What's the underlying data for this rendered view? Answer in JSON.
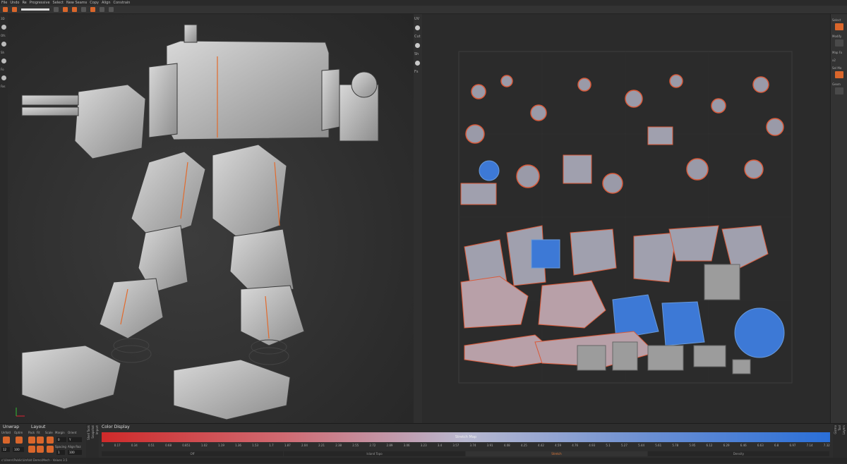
{
  "menubar": {
    "items": [
      "File",
      "Undo",
      "Re",
      "Progressive",
      "Select",
      "New Seams",
      "Copy",
      "Align",
      "Constrain"
    ]
  },
  "viewport_left": {
    "side_labels": [
      "3D",
      "Ofs",
      "Sh",
      "Fo",
      "Fas"
    ]
  },
  "divider": {
    "labels": [
      "UV",
      "Cut",
      "Sh",
      "Fs"
    ]
  },
  "right_strip": {
    "labels": [
      "Select",
      "Modify",
      "Map Fa",
      "Sel Mo",
      "Geom"
    ],
    "value": "x2"
  },
  "unwrap": {
    "title": "Unwrap",
    "title2": "Layout",
    "col_labels": [
      "Unfold",
      "Optim",
      "Pack",
      "Fit",
      "Scale",
      "Margin",
      "Orient"
    ],
    "field_values": [
      "12",
      "100",
      "0",
      "1",
      "100"
    ],
    "spacing_label": "Spacing",
    "align_label": "Align Roz",
    "dropdown": "Y"
  },
  "vertical_tabs": [
    "Shell Tools",
    "Snapshot",
    "Import"
  ],
  "color_display": {
    "title": "Color Display",
    "stretch_label": "Stretch Map",
    "ticks": [
      "0",
      "0.17",
      "0.34",
      "0.51",
      "0.68",
      "0.851",
      "1.02",
      "1.19",
      "1.36",
      "1.53",
      "1.7",
      "1.87",
      "2.04",
      "2.21",
      "2.38",
      "2.55",
      "2.72",
      "2.89",
      "3.06",
      "3.23",
      "3.4",
      "3.57",
      "3.74",
      "3.91",
      "4.08",
      "4.25",
      "4.42",
      "4.59",
      "4.76",
      "4.93",
      "5.1",
      "5.27",
      "5.44",
      "5.61",
      "5.78",
      "5.95",
      "6.12",
      "6.29",
      "6.46",
      "6.63",
      "6.8",
      "6.97",
      "7.14",
      "7.32"
    ],
    "modes": [
      "Off",
      "Island Topo",
      "Stretch",
      "Density"
    ],
    "active_mode": "Stretch"
  },
  "bottom_right_tabs": [
    "Gizmo",
    "Tool",
    "Layers"
  ],
  "status": "c:\\Users\\Public\\Unfold Demo\\Mech - Values 3.5",
  "colors": {
    "accent": "#d9662b",
    "stretch_low": "#cf2a2a",
    "stretch_high": "#2a6fd8"
  }
}
